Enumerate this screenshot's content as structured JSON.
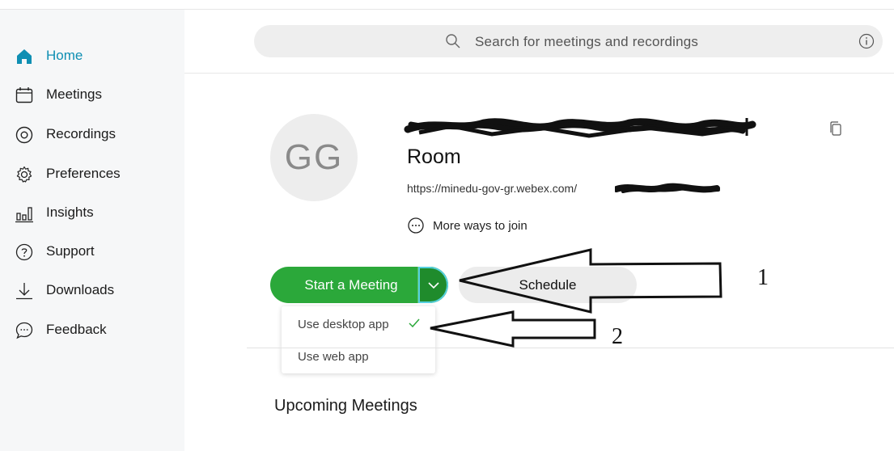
{
  "sidebar": {
    "items": [
      {
        "label": "Home",
        "icon": "home-icon",
        "active": true
      },
      {
        "label": "Meetings",
        "icon": "calendar-icon"
      },
      {
        "label": "Recordings",
        "icon": "record-icon"
      },
      {
        "label": "Preferences",
        "icon": "gear-icon"
      },
      {
        "label": "Insights",
        "icon": "insights-icon"
      },
      {
        "label": "Support",
        "icon": "help-icon"
      },
      {
        "label": "Downloads",
        "icon": "download-icon"
      },
      {
        "label": "Feedback",
        "icon": "chat-icon"
      }
    ]
  },
  "search": {
    "placeholder": "Search for meetings and recordings"
  },
  "room": {
    "avatar_initials": "GG",
    "title": "Room",
    "url": "https://minedu-gov-gr.webex.com/",
    "more_ways": "More ways to join"
  },
  "actions": {
    "start_label": "Start a Meeting",
    "schedule_label": "Schedule"
  },
  "join_menu": {
    "items": [
      {
        "label": "Use desktop app",
        "selected": true
      },
      {
        "label": "Use web app",
        "selected": false
      }
    ]
  },
  "upcoming": {
    "heading": "Upcoming Meetings"
  },
  "annotations": {
    "label_1": "1",
    "label_2": "2"
  },
  "colors": {
    "accent": "#0f8fb3",
    "start_green": "#2ba83a",
    "start_dark": "#1f8b2c"
  }
}
